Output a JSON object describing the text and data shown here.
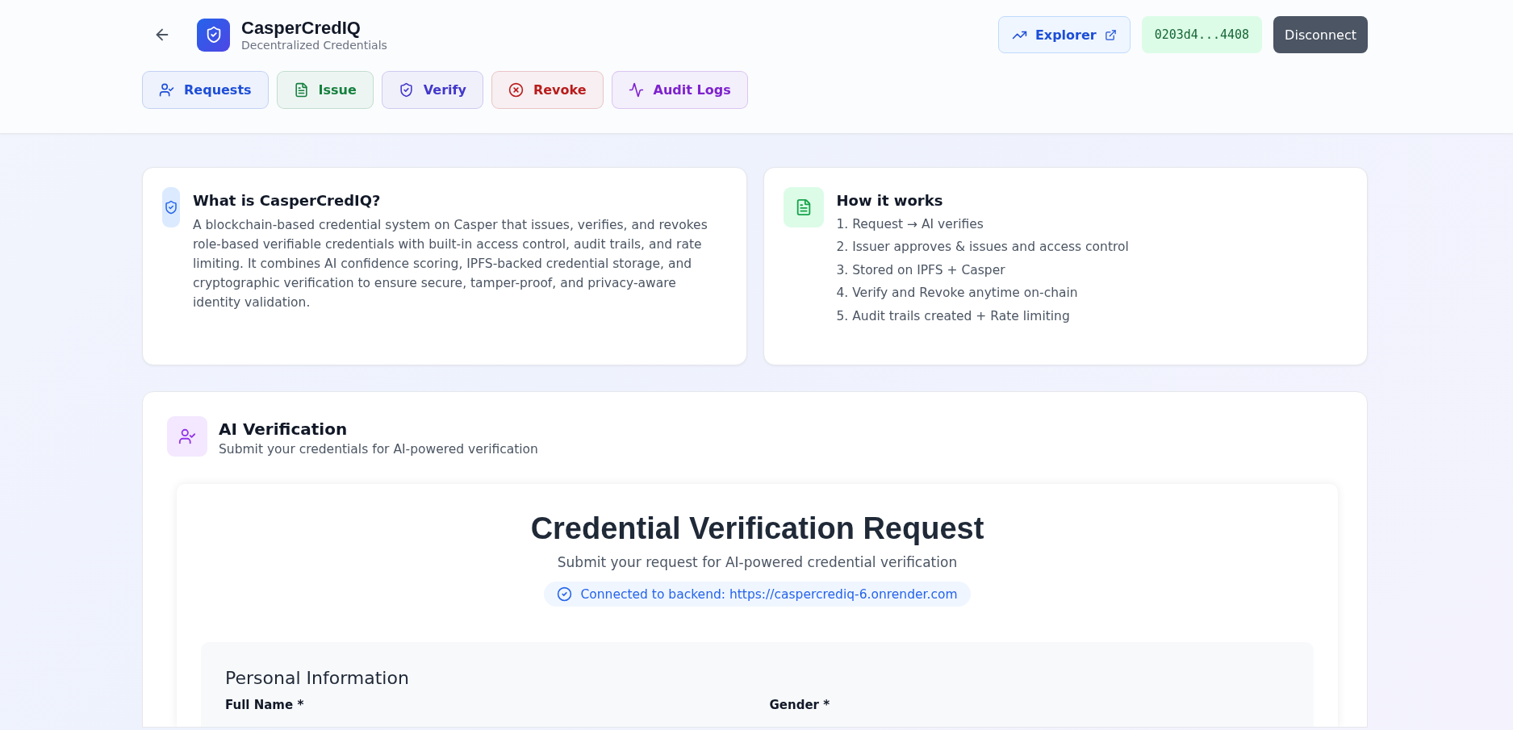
{
  "header": {
    "title": "CasperCredIQ",
    "subtitle": "Decentralized Credentials",
    "explorer": "Explorer",
    "address": "0203d4...4408",
    "disconnect": "Disconnect"
  },
  "nav": [
    {
      "label": "Requests",
      "kind": "requests",
      "color": "#1d4ed8"
    },
    {
      "label": "Issue",
      "kind": "issue",
      "color": "#15803d"
    },
    {
      "label": "Verify",
      "kind": "verify",
      "color": "#4338ca"
    },
    {
      "label": "Revoke",
      "kind": "revoke",
      "color": "#b91c1c"
    },
    {
      "label": "Audit Logs",
      "kind": "audit",
      "color": "#7e22ce"
    }
  ],
  "about": {
    "title": "What is CasperCredIQ?",
    "text": "A blockchain-based credential system on Casper that issues, verifies, and revokes role-based verifiable credentials with built-in access control, audit trails, and rate limiting. It combines AI confidence scoring, IPFS-backed credential storage, and cryptographic verification to ensure secure, tamper-proof, and privacy-aware identity validation."
  },
  "how": {
    "title": "How it works",
    "steps": [
      "1. Request → AI verifies",
      "2. Issuer approves & issues and access control",
      "3. Stored on IPFS + Casper",
      "4. Verify and Revoke anytime on-chain",
      "5. Audit trails created + Rate limiting"
    ]
  },
  "section": {
    "title": "AI Verification",
    "subtitle": "Submit your credentials for AI-powered verification"
  },
  "form": {
    "title": "Credential Verification Request",
    "subtitle": "Submit your request for AI-powered credential verification",
    "status": "Connected to backend: https://caspercrediq-6.onrender.com",
    "group": "Personal Information",
    "fields": [
      {
        "label": "Full Name *"
      },
      {
        "label": "Gender *"
      }
    ]
  }
}
